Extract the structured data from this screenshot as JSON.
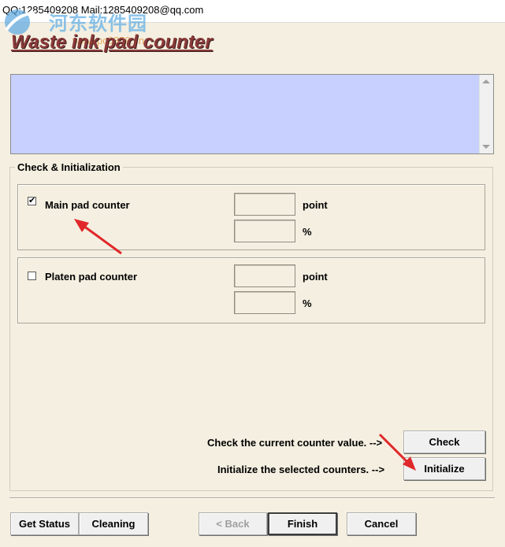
{
  "window": {
    "title": "QQ:1285409208 Mail:1285409208@qq.com"
  },
  "watermark": {
    "text": "河东软件园",
    "url": "www.pc0359.cn"
  },
  "heading": "Waste ink pad counter",
  "group": {
    "legend": "Check & Initialization",
    "counters": [
      {
        "label": "Main pad counter",
        "checked": true,
        "check_mark": "✔",
        "point_value": "",
        "percent_value": "",
        "point_unit": "point",
        "percent_unit": "%"
      },
      {
        "label": "Platen pad counter",
        "checked": false,
        "check_mark": "",
        "point_value": "",
        "percent_value": "",
        "point_unit": "point",
        "percent_unit": "%"
      }
    ],
    "check_hint": "Check the current counter value. -->",
    "init_hint": "Initialize the selected counters. -->",
    "check_button": "Check",
    "init_button": "Initialize"
  },
  "footer": {
    "get_status": "Get Status",
    "cleaning": "Cleaning",
    "back": "< Back",
    "finish": "Finish",
    "cancel": "Cancel"
  },
  "colors": {
    "heading": "#8b3a3a",
    "text_area": "#c8d0ff",
    "dialog_bg": "#f4efe0",
    "annotation_arrow": "#e0282a"
  }
}
